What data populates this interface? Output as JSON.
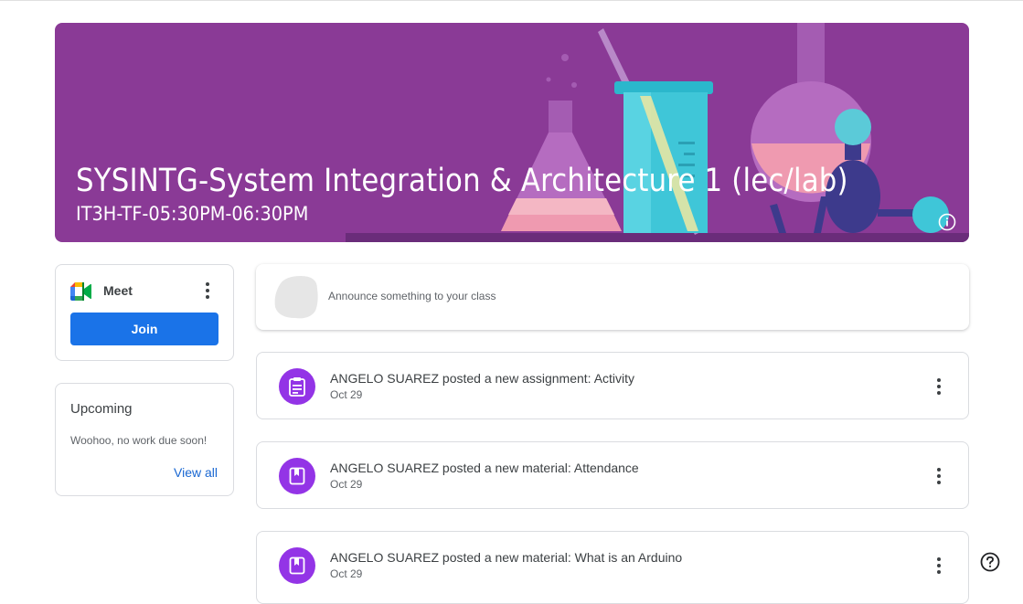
{
  "banner": {
    "title": "SYSINTG-System Integration & Architecture 1 (lec/lab)",
    "subtitle": "IT3H-TF-05:30PM-06:30PM",
    "color": "#8a3a96",
    "info_icon": "info-icon"
  },
  "meet": {
    "label": "Meet",
    "join_label": "Join",
    "icon": "google-meet-icon"
  },
  "upcoming": {
    "title": "Upcoming",
    "message": "Woohoo, no work due soon!",
    "view_all": "View all"
  },
  "announce": {
    "placeholder": "Announce something to your class"
  },
  "stream": [
    {
      "title": "ANGELO SUAREZ posted a new assignment: Activity",
      "date": "Oct 29",
      "icon": "assignment-icon"
    },
    {
      "title": "ANGELO SUAREZ posted a new material: Attendance",
      "date": "Oct 29",
      "icon": "material-icon"
    },
    {
      "title": "ANGELO SUAREZ posted a new material: What is an Arduino",
      "date": "Oct 29",
      "icon": "material-icon"
    }
  ],
  "colors": {
    "accent": "#1a73e8",
    "post_icon_bg": "#9334e6",
    "link": "#1967d2"
  },
  "help_icon": "help-icon"
}
